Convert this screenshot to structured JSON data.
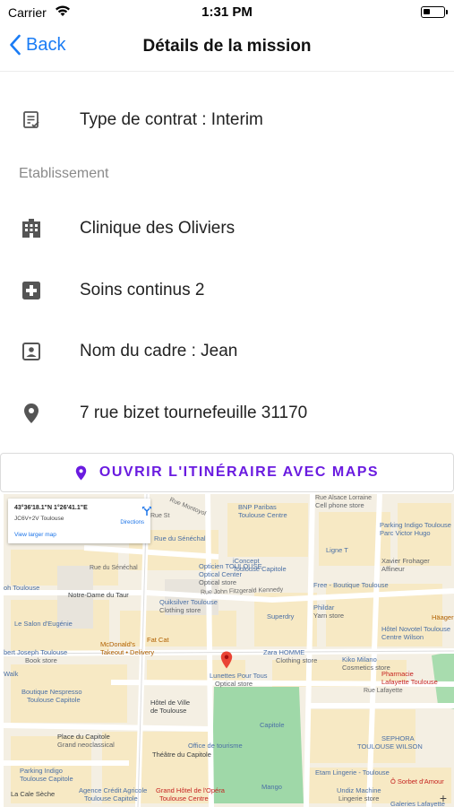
{
  "status_bar": {
    "carrier": "Carrier",
    "time": "1:31 PM"
  },
  "nav": {
    "back_label": "Back",
    "title": "Détails de la mission"
  },
  "rows": {
    "contract": "Type de contrat : Interim",
    "section_label": "Etablissement",
    "clinic": "Clinique des Oliviers",
    "service": "Soins continus 2",
    "manager": "Nom du cadre : Jean",
    "address": "7 rue bizet tournefeuille 31170"
  },
  "maps_button": {
    "label": "OUVRIR L'ITINÉRAIRE AVEC MAPS"
  },
  "map": {
    "info_card": {
      "coords": "43°36'18.1\"N 1°26'41.1\"E",
      "plus_code": "JC6V+2V Toulouse",
      "larger_link": "View larger map",
      "directions": "Directions"
    },
    "zoom_label": "+",
    "labels": {
      "rue_montoyol": "Rue Montoyol",
      "rue_saint": "Rue St",
      "bnp": "BNP Paribas",
      "toulouse_centre": "Toulouse Centre",
      "cell_phone": "Cell phone store",
      "parking_indigo_tl": "Parking Indigo Toulouse",
      "parc_victor_hugo": "Parc Victor Hugo",
      "rue_alsace": "Rue Alsace Lorraine",
      "senechal": "Rue du Sénéchal",
      "iconcept": "iConcept",
      "toulouse_capitole": "Toulouse Capitole",
      "ligne_t": "Ligne T",
      "xavier": "Xavier Frohager",
      "affineur": "Affineur",
      "rue_senechal": "Rue du Sénéchal",
      "opticien": "Opticien TOULOUSE",
      "optical_center": "Optical Center",
      "optical_store": "Optical store",
      "rue_jfk": "Rue John Fitzgerald Kennedy",
      "free": "Free - Boutique Toulouse",
      "toulouse_left": "oh Toulouse",
      "notre_dame": "Notre-Dame du Taur",
      "quiksilver": "Quiksilver Toulouse",
      "clothing_store": "Clothing store",
      "superdry": "Superdry",
      "phildar": "Phildar",
      "yarn_store": "Yarn store",
      "hauger": "Häager",
      "salon": "Le Salon d'Eugénie",
      "mcdonalds": "McDonald's",
      "takeout": "Takeout • Delivery",
      "fat_cat": "Fat Cat",
      "zara_homme": "Zara HOMME",
      "clothing_store2": "Clothing store",
      "novotel": "Hôtel Novotel Toulouse",
      "centre_wilson": "Centre Wilson",
      "joseph": "bert Joseph Toulouse",
      "book_store": "Book store",
      "lunettes": "Lunettes Pour Tous",
      "optical_store2": "Optical store",
      "kiko": "Kiko Milano",
      "cosmetics": "Cosmetics store",
      "pharmacie": "Pharmacie",
      "lafayette": "Lafayette Toulouse",
      "walk": "Walk",
      "nespresso": "Boutique Nespresso",
      "nespresso_2": "Toulouse Capitole",
      "hotel_ville": "Hôtel de Ville",
      "de_toulouse": "de Toulouse",
      "rue_lafayette": "Rue Lafayette",
      "capitole": "Capitole",
      "place_capitole": "Place du Capitole",
      "grand_place": "Grand neoclassical",
      "sephora": "SEPHORA",
      "sephora_2": "TOULOUSE WILSON",
      "office": "Office de tourisme",
      "theatre": "Théâtre du Capitole",
      "parking_indigo": "Parking Indigo",
      "parking_indigo_2": "Toulouse Capitole",
      "etam": "Etam Lingerie - Toulouse",
      "sorbet": "Ô Sorbet d'Amour",
      "caisse": "La Cale Sèche",
      "agence": "Agence Crédit Agricole",
      "agence_2": "Toulouse Capitole",
      "grand_hotel": "Grand Hôtel de l'Opéra",
      "grand_hotel_2": "Toulouse Centre",
      "mango": "Mango",
      "undiz": "Undiz Machine",
      "undiz_2": "Lingerie store",
      "galeries": "Galeries Lafayette",
      "place_du": "Place du"
    }
  }
}
